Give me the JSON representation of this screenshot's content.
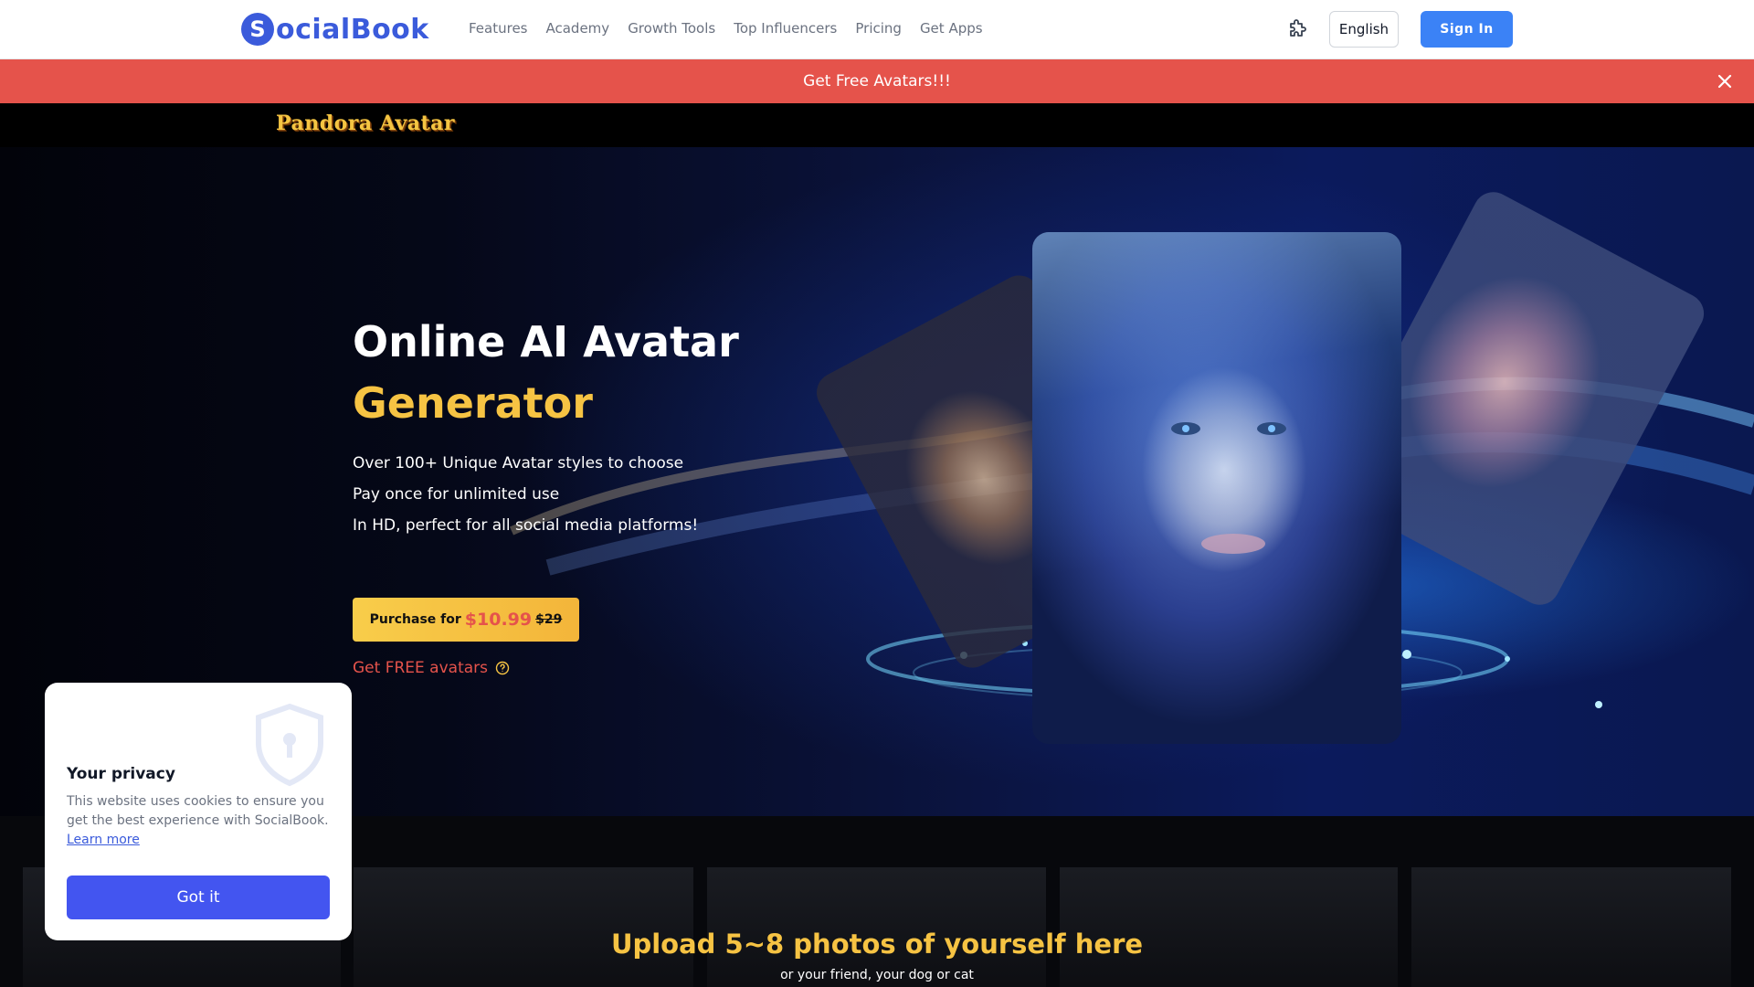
{
  "header": {
    "logo_mark": "S",
    "logo_text": "ocialBook",
    "nav": [
      "Features",
      "Academy",
      "Growth Tools",
      "Top Influencers",
      "Pricing",
      "Get Apps"
    ],
    "language": "English",
    "signin": "Sign In"
  },
  "promo": {
    "text": "Get Free Avatars!!!"
  },
  "brand": {
    "title": "Pandora Avatar"
  },
  "hero": {
    "title_line1": "Online AI Avatar",
    "title_line2": "Generator",
    "features": [
      "Over 100+ Unique Avatar styles to choose",
      "Pay once for unlimited use",
      "In HD, perfect for all social media platforms!"
    ],
    "purchase": {
      "label": "Purchase for",
      "price": "$10.99",
      "old_price": "$29"
    },
    "free_link": "Get FREE avatars"
  },
  "upload": {
    "title": "Upload 5~8 photos of yourself here",
    "subtitle": "or your friend, your dog or cat"
  },
  "privacy": {
    "title": "Your privacy",
    "text": "This website uses cookies to ensure you get the best experience with SocialBook.",
    "link": "Learn more",
    "button": "Got it"
  },
  "colors": {
    "brand_blue": "#3b5bdb",
    "accent_yellow": "#f6c343",
    "promo_red": "#e5534b",
    "signin_blue": "#3b82f6"
  },
  "icons": [
    "extension-icon",
    "close-icon",
    "help-icon",
    "shield-icon"
  ]
}
